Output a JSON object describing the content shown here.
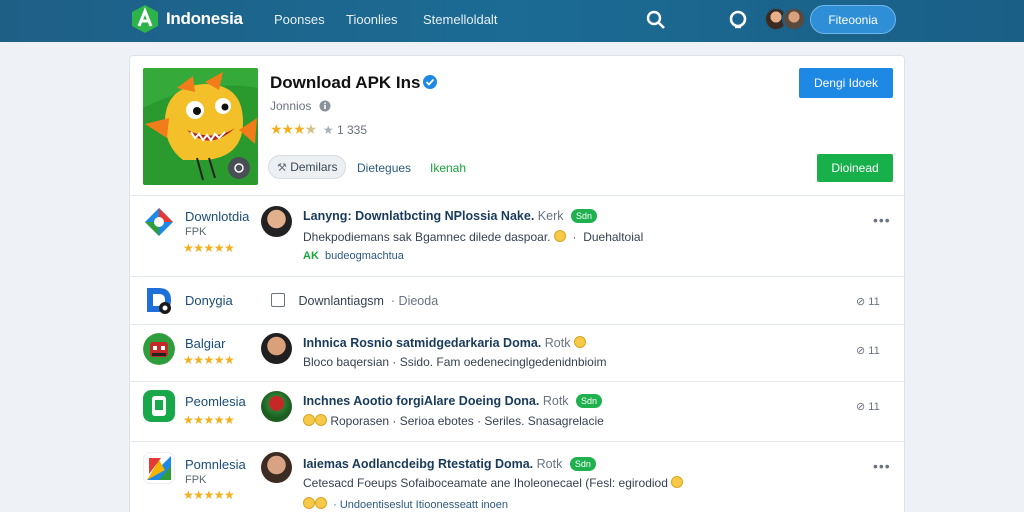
{
  "header": {
    "brand": "Indonesia",
    "nav": [
      "Poonses",
      "Tioonlies",
      "Stemelloldalt"
    ],
    "button": "Fiteoonia"
  },
  "hero": {
    "title": "Download APK Ins",
    "developer": "Jonnios",
    "rating_count": "1 335",
    "rating": 3.5,
    "top_button": "Dengi Idoek",
    "chip": "Demilars",
    "link1": "Dietegues",
    "link2": "Ikenah",
    "green_button": "Dioinead"
  },
  "rows": [
    {
      "name": "Downlotdia",
      "sub": "FPK",
      "headline": "Lanyng: Downlatbcting NPlossia Nake.",
      "meta": "Kerk",
      "badge": "Sdn",
      "text": "Dhekpodiemans sak Bgamnec dilede daspoar.",
      "text_tail": "Duehaltoial",
      "foot_green": "AK",
      "foot": "budeogmachtua"
    },
    {
      "name": "Donygia",
      "headline": "Downlantiagsm",
      "meta": "Dieoda",
      "count": "11"
    },
    {
      "name": "Balgiar",
      "headline": "Inhnica Rosnio satmidgedarkaria Doma.",
      "meta": "Rotk",
      "text": "Bloco baqersian · Ssido. Fam oedenecinglgedenidnbioim",
      "count": "11"
    },
    {
      "name": "Peomlesia",
      "headline": "Inchnes Aootio forgiAlare Doeing Dona.",
      "meta": "Rotk",
      "badge": "Sdn",
      "text": "Roporasen · Serioa ebotes · Seriles. Snasagrelacie",
      "count": "11"
    },
    {
      "name": "Pomnlesia",
      "sub": "FPK",
      "headline": "Iaiemas Aodlancdeibg Rtestatig Doma.",
      "meta": "Rotk",
      "badge": "Sdn",
      "text": "Cetesacd Foeups Sofaiboceamate ane Iholeonecael (Fesl: egirodiod",
      "foot": "Undoentiseslut Itioonesseatt inoen"
    }
  ]
}
